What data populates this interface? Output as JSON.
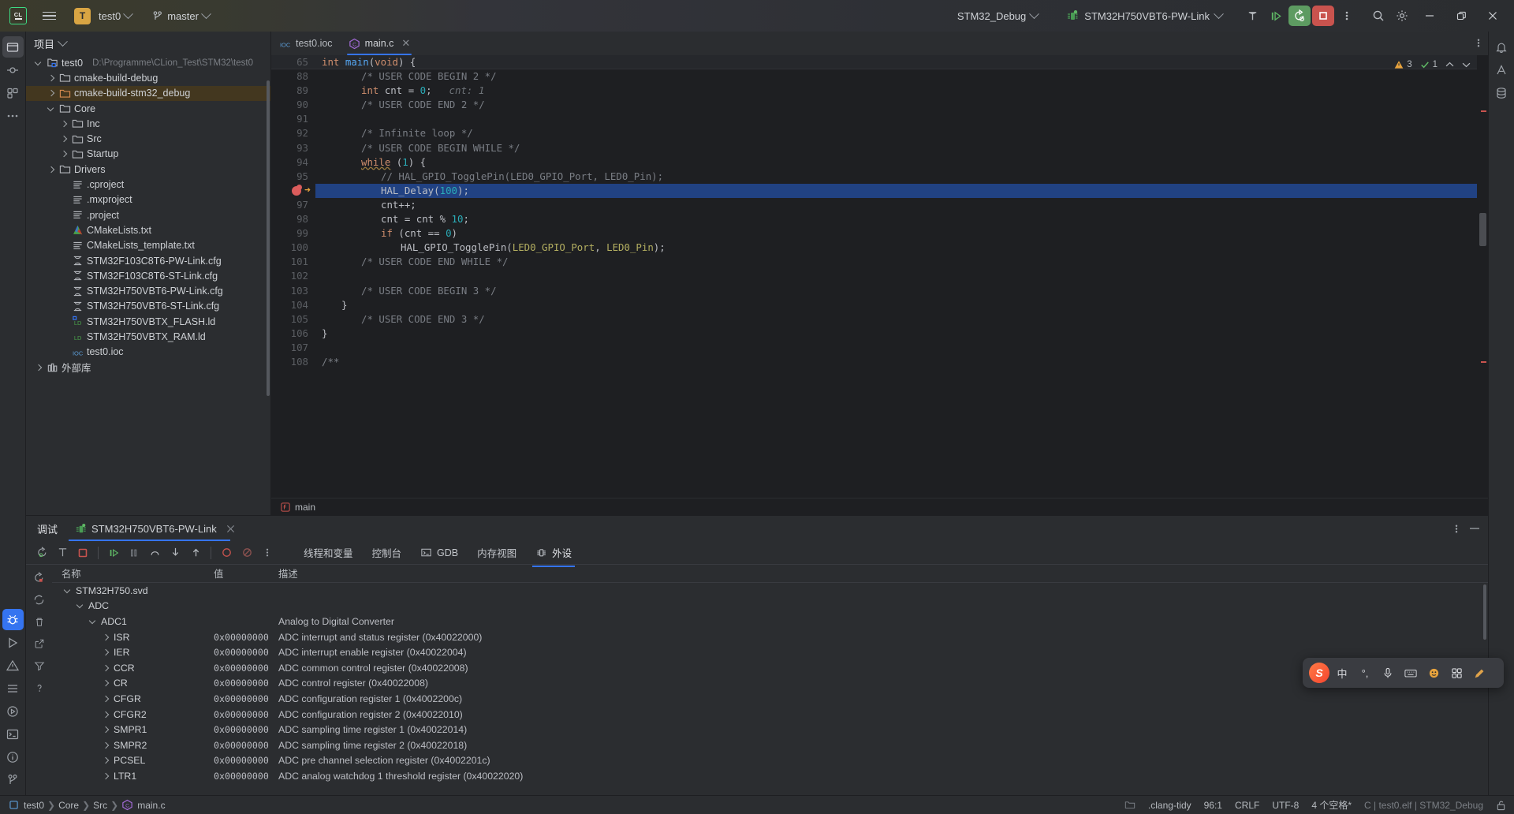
{
  "titlebar": {
    "logo": "clion-logo",
    "project_badge": "T",
    "project_name": "test0",
    "branch": "master",
    "run_config": "STM32_Debug",
    "device": "STM32H750VBT6-PW-Link"
  },
  "project_panel": {
    "title": "项目",
    "tree": [
      {
        "depth": 0,
        "arrow": "d",
        "icon": "project-icon",
        "label": "test0",
        "path": "D:\\Programme\\CLion_Test\\STM32\\test0",
        "selected": false
      },
      {
        "depth": 1,
        "arrow": "r",
        "icon": "folder-icon",
        "label": "cmake-build-debug",
        "path": "",
        "selected": false
      },
      {
        "depth": 1,
        "arrow": "r",
        "icon": "folder-orange-icon",
        "label": "cmake-build-stm32_debug",
        "path": "",
        "selected": true
      },
      {
        "depth": 1,
        "arrow": "d",
        "icon": "folder-icon",
        "label": "Core",
        "path": "",
        "selected": false
      },
      {
        "depth": 2,
        "arrow": "r",
        "icon": "folder-icon",
        "label": "Inc",
        "path": "",
        "selected": false
      },
      {
        "depth": 2,
        "arrow": "r",
        "icon": "folder-icon",
        "label": "Src",
        "path": "",
        "selected": false
      },
      {
        "depth": 2,
        "arrow": "r",
        "icon": "folder-icon",
        "label": "Startup",
        "path": "",
        "selected": false
      },
      {
        "depth": 1,
        "arrow": "r",
        "icon": "folder-icon",
        "label": "Drivers",
        "path": "",
        "selected": false
      },
      {
        "depth": 2,
        "arrow": "",
        "icon": "text-file-icon",
        "label": ".cproject",
        "path": "",
        "selected": false
      },
      {
        "depth": 2,
        "arrow": "",
        "icon": "text-file-icon",
        "label": ".mxproject",
        "path": "",
        "selected": false
      },
      {
        "depth": 2,
        "arrow": "",
        "icon": "text-file-icon",
        "label": ".project",
        "path": "",
        "selected": false
      },
      {
        "depth": 2,
        "arrow": "",
        "icon": "cmake-icon",
        "label": "CMakeLists.txt",
        "path": "",
        "selected": false
      },
      {
        "depth": 2,
        "arrow": "",
        "icon": "text-file-icon",
        "label": "CMakeLists_template.txt",
        "path": "",
        "selected": false
      },
      {
        "depth": 2,
        "arrow": "",
        "icon": "cfg-file-icon",
        "label": "STM32F103C8T6-PW-Link.cfg",
        "path": "",
        "selected": false
      },
      {
        "depth": 2,
        "arrow": "",
        "icon": "cfg-file-icon",
        "label": "STM32F103C8T6-ST-Link.cfg",
        "path": "",
        "selected": false
      },
      {
        "depth": 2,
        "arrow": "",
        "icon": "cfg-file-icon",
        "label": "STM32H750VBT6-PW-Link.cfg",
        "path": "",
        "selected": false
      },
      {
        "depth": 2,
        "arrow": "",
        "icon": "cfg-file-icon",
        "label": "STM32H750VBT6-ST-Link.cfg",
        "path": "",
        "selected": false
      },
      {
        "depth": 2,
        "arrow": "",
        "icon": "ld-file-icon",
        "label": "STM32H750VBTX_FLASH.ld",
        "path": "",
        "selected": false
      },
      {
        "depth": 2,
        "arrow": "",
        "icon": "ld-file-plain-icon",
        "label": "STM32H750VBTX_RAM.ld",
        "path": "",
        "selected": false
      },
      {
        "depth": 2,
        "arrow": "",
        "icon": "ioc-file-icon",
        "label": "test0.ioc",
        "path": "",
        "selected": false
      },
      {
        "depth": 0,
        "arrow": "r",
        "icon": "library-icon",
        "label": "外部库",
        "path": "",
        "selected": false
      }
    ]
  },
  "editor": {
    "tabs": [
      {
        "icon": "ioc-file-icon",
        "label": "test0.ioc",
        "active": false,
        "closable": false
      },
      {
        "icon": "c-file-icon",
        "label": "main.c",
        "active": true,
        "closable": true
      }
    ],
    "inspection": {
      "warnings": "3",
      "checks": "1"
    },
    "sticky_line": {
      "number": "65",
      "text": "int main(void) {"
    },
    "lines": [
      {
        "number": "88",
        "indent": 2,
        "text": "/* USER CODE BEGIN 2 */",
        "kind": "comment"
      },
      {
        "number": "89",
        "indent": 2,
        "text": "int cnt = 0;",
        "kind": "decl",
        "inlay": "cnt: 1"
      },
      {
        "number": "90",
        "indent": 2,
        "text": "/* USER CODE END 2 */",
        "kind": "comment"
      },
      {
        "number": "91",
        "indent": 0,
        "text": "",
        "kind": "plain"
      },
      {
        "number": "92",
        "indent": 2,
        "text": "/* Infinite loop */",
        "kind": "comment"
      },
      {
        "number": "93",
        "indent": 2,
        "text": "/* USER CODE BEGIN WHILE */",
        "kind": "comment"
      },
      {
        "number": "94",
        "indent": 2,
        "text": "while (1) {",
        "kind": "while"
      },
      {
        "number": "95",
        "indent": 3,
        "text": "// HAL_GPIO_TogglePin(LED0_GPIO_Port, LED0_Pin);",
        "kind": "comment"
      },
      {
        "number": "96",
        "indent": 3,
        "text": "HAL_Delay(100);",
        "kind": "call",
        "highlighted": true,
        "breakpoint": true,
        "exec": true
      },
      {
        "number": "97",
        "indent": 3,
        "text": "cnt++;",
        "kind": "plain"
      },
      {
        "number": "98",
        "indent": 3,
        "text": "cnt = cnt % 10;",
        "kind": "mod"
      },
      {
        "number": "99",
        "indent": 3,
        "text": "if (cnt == 0)",
        "kind": "if"
      },
      {
        "number": "100",
        "indent": 4,
        "text": "HAL_GPIO_TogglePin(LED0_GPIO_Port, LED0_Pin);",
        "kind": "toggle"
      },
      {
        "number": "101",
        "indent": 2,
        "text": "/* USER CODE END WHILE */",
        "kind": "comment"
      },
      {
        "number": "102",
        "indent": 0,
        "text": "",
        "kind": "plain"
      },
      {
        "number": "103",
        "indent": 2,
        "text": "/* USER CODE BEGIN 3 */",
        "kind": "comment"
      },
      {
        "number": "104",
        "indent": 1,
        "text": "}",
        "kind": "plain"
      },
      {
        "number": "105",
        "indent": 2,
        "text": "/* USER CODE END 3 */",
        "kind": "comment"
      },
      {
        "number": "106",
        "indent": 0,
        "text": "}",
        "kind": "plain"
      },
      {
        "number": "107",
        "indent": 0,
        "text": "",
        "kind": "plain"
      },
      {
        "number": "108",
        "indent": 0,
        "text": "/**",
        "kind": "comment"
      }
    ],
    "breadcrumb": "main"
  },
  "debug": {
    "title": "调试",
    "session_tab": "STM32H750VBT6-PW-Link",
    "toolbar_icons": [
      "resume-program-icon",
      "rerun-icon",
      "stop-icon",
      "resume-icon",
      "pause-icon",
      "step-over-icon",
      "step-into-icon",
      "step-out-icon",
      "view-breakpoints-icon",
      "mute-breakpoints-icon",
      "more-options-icon"
    ],
    "tabs": [
      {
        "label": "线程和变量",
        "icon": "",
        "active": false
      },
      {
        "label": "控制台",
        "icon": "",
        "active": false
      },
      {
        "label": "GDB",
        "icon": "gdb-icon",
        "active": false
      },
      {
        "label": "内存视图",
        "icon": "",
        "active": false
      },
      {
        "label": "外设",
        "icon": "peripherals-icon",
        "active": true
      }
    ],
    "columns": {
      "name": "名称",
      "value": "值",
      "description": "描述"
    },
    "rows": [
      {
        "depth": 0,
        "arrow": "d",
        "name": "STM32H750.svd",
        "value": "",
        "desc": ""
      },
      {
        "depth": 1,
        "arrow": "d",
        "name": "ADC",
        "value": "",
        "desc": ""
      },
      {
        "depth": 2,
        "arrow": "d",
        "name": "ADC1",
        "value": "",
        "desc": "Analog to Digital Converter"
      },
      {
        "depth": 3,
        "arrow": "r",
        "name": "ISR",
        "value": "0x00000000",
        "desc": "ADC interrupt and status register (0x40022000)"
      },
      {
        "depth": 3,
        "arrow": "r",
        "name": "IER",
        "value": "0x00000000",
        "desc": "ADC interrupt enable register (0x40022004)"
      },
      {
        "depth": 3,
        "arrow": "r",
        "name": "CCR",
        "value": "0x00000000",
        "desc": "ADC common control register (0x40022008)"
      },
      {
        "depth": 3,
        "arrow": "r",
        "name": "CR",
        "value": "0x00000000",
        "desc": "ADC control register (0x40022008)"
      },
      {
        "depth": 3,
        "arrow": "r",
        "name": "CFGR",
        "value": "0x00000000",
        "desc": "ADC configuration register 1 (0x4002200c)"
      },
      {
        "depth": 3,
        "arrow": "r",
        "name": "CFGR2",
        "value": "0x00000000",
        "desc": "ADC configuration register 2 (0x40022010)"
      },
      {
        "depth": 3,
        "arrow": "r",
        "name": "SMPR1",
        "value": "0x00000000",
        "desc": "ADC sampling time register 1 (0x40022014)"
      },
      {
        "depth": 3,
        "arrow": "r",
        "name": "SMPR2",
        "value": "0x00000000",
        "desc": "ADC sampling time register 2 (0x40022018)"
      },
      {
        "depth": 3,
        "arrow": "r",
        "name": "PCSEL",
        "value": "0x00000000",
        "desc": "ADC pre channel selection register (0x4002201c)"
      },
      {
        "depth": 3,
        "arrow": "r",
        "name": "LTR1",
        "value": "0x00000000",
        "desc": "ADC analog watchdog 1 threshold register (0x40022020)"
      }
    ]
  },
  "statusbar": {
    "breadcrumbs": [
      "test0",
      "Core",
      "Src",
      "main.c"
    ],
    "clang_tidy": ".clang-tidy",
    "caret": "96:1",
    "line_sep": "CRLF",
    "encoding": "UTF-8",
    "indent": "4 个空格*",
    "target": "C | test0.elf | STM32_Debug"
  },
  "ime": {
    "logo": "S",
    "buttons": [
      "中",
      "°,",
      "mic-icon",
      "keyboard-icon",
      "emoji-icon",
      "apps-icon",
      "pen-icon"
    ]
  },
  "colors": {
    "accent": "#3574f0",
    "selection": "#214283",
    "tree_selection": "#43371f",
    "green": "#5d9b61",
    "red": "#c9534e",
    "panel": "#2b2d30",
    "editor_bg": "#1e1f22"
  }
}
